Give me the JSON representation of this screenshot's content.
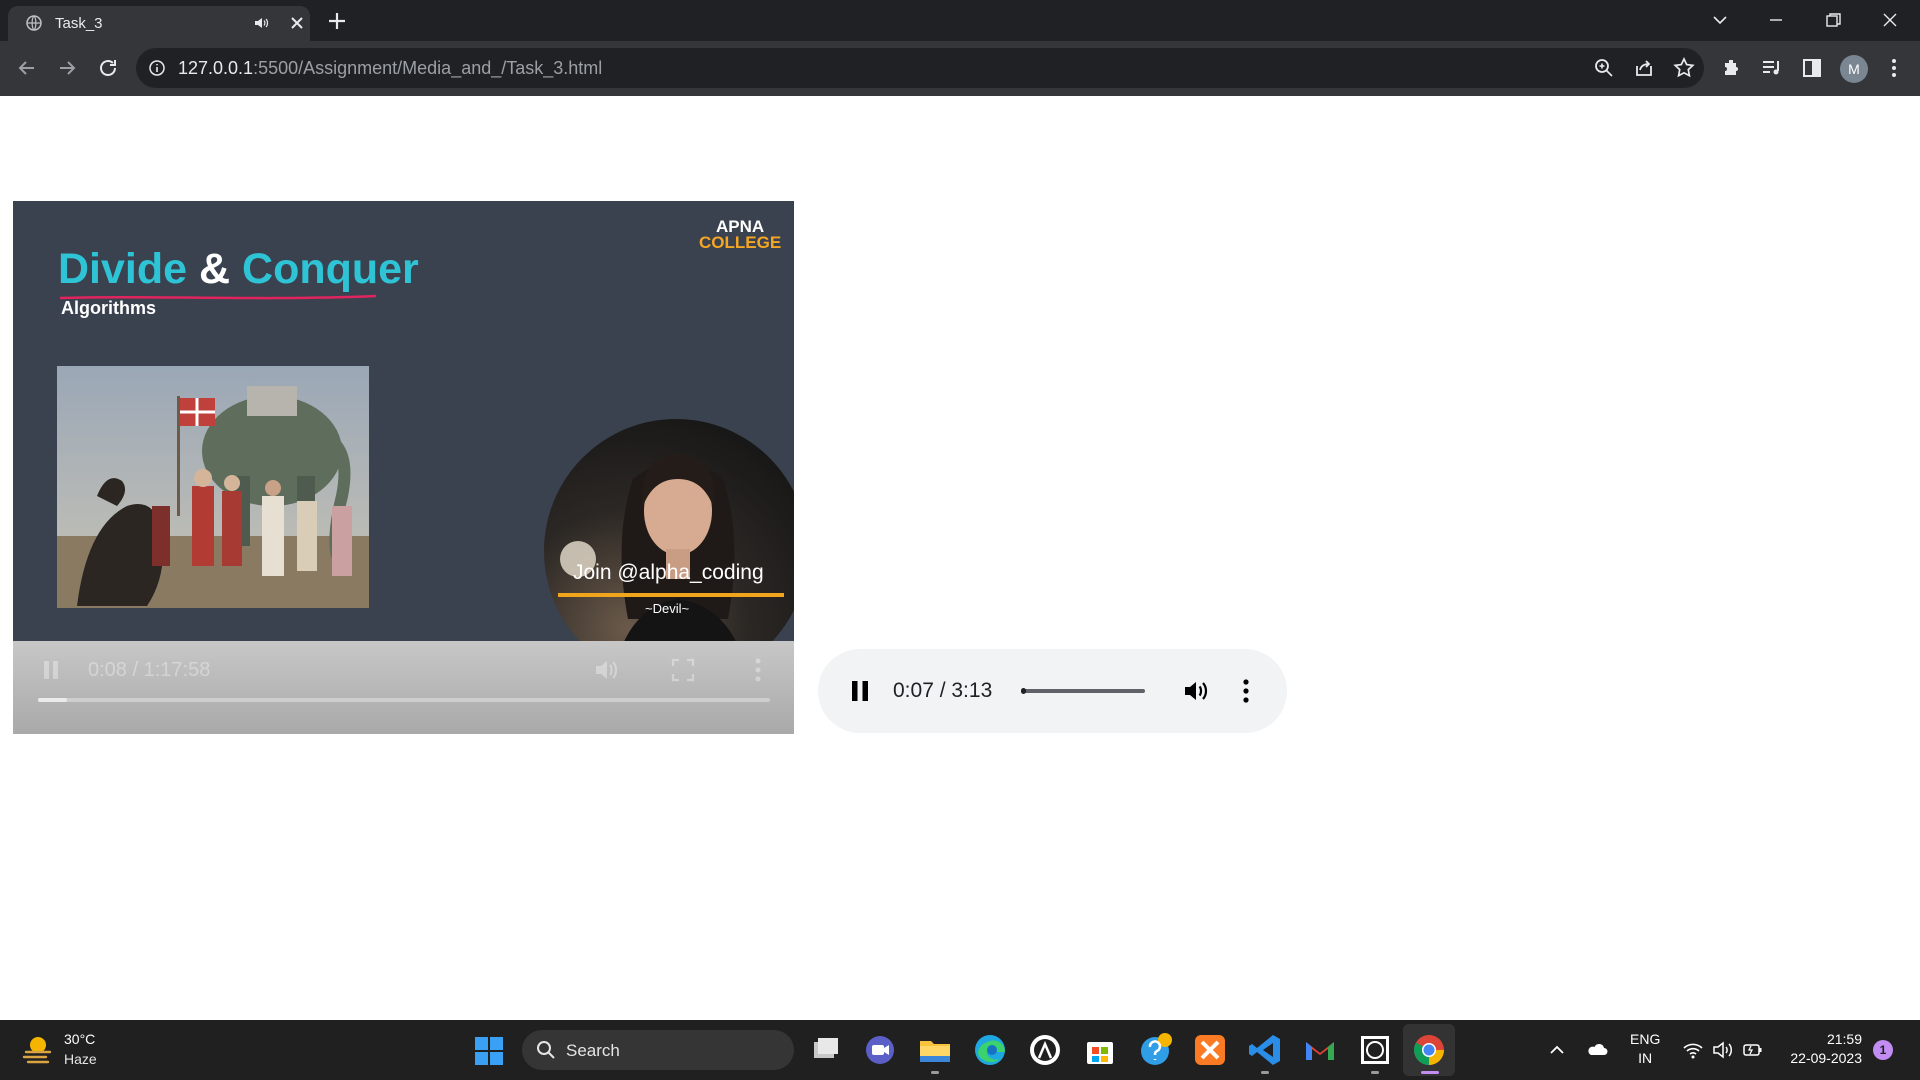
{
  "browser": {
    "tab": {
      "title": "Task_3"
    },
    "url": {
      "host": "127.0.0.1",
      "path": ":5500/Assignment/Media_and_/Task_3.html"
    },
    "profile_initial": "M"
  },
  "video": {
    "overlay": {
      "brand_line1": "APNA",
      "brand_line2": "COLLEGE",
      "title_part1": "Divide",
      "title_amp": "&",
      "title_part2": "Conquer",
      "subtitle": "Algorithms",
      "join_text": "Join @alpha_coding",
      "signature": "~Devil~"
    },
    "controls": {
      "time": "0:08 / 1:17:58",
      "progress": 0.007
    }
  },
  "audio": {
    "time": "0:07 / 3:13",
    "progress": 0.04
  },
  "taskbar": {
    "weather": {
      "temp": "30°C",
      "condition": "Haze"
    },
    "search_label": "Search",
    "language": {
      "line1": "ENG",
      "line2": "IN"
    },
    "clock": {
      "time": "21:59",
      "date": "22-09-2023"
    },
    "notifications": "1"
  }
}
